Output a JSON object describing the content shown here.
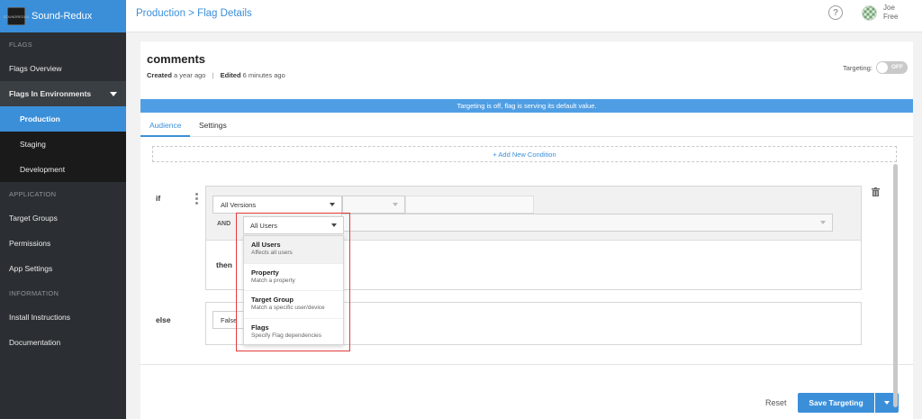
{
  "app": {
    "name": "Sound-Redux",
    "logo_text": "SOUNDREDUX"
  },
  "breadcrumb": "Production > Flag Details",
  "user": {
    "name": "Joe",
    "plan": "Free"
  },
  "sidebar": {
    "sections": [
      {
        "label": "FLAGS"
      },
      {
        "label": "APPLICATION"
      },
      {
        "label": "INFORMATION"
      }
    ],
    "items": {
      "flags_overview": "Flags Overview",
      "flags_in_environments": "Flags In Environments",
      "production": "Production",
      "staging": "Staging",
      "development": "Development",
      "target_groups": "Target Groups",
      "permissions": "Permissions",
      "app_settings": "App Settings",
      "install_instructions": "Install Instructions",
      "documentation": "Documentation"
    }
  },
  "flag": {
    "name": "comments",
    "created_label": "Created",
    "created_value": "a year ago",
    "edited_label": "Edited",
    "edited_value": "6 minutes ago"
  },
  "targeting": {
    "label": "Targeting:",
    "state": "OFF"
  },
  "banner": "Targeting is off, flag is serving its default value.",
  "tabs": [
    "Audience",
    "Settings"
  ],
  "add_condition": "+ Add New Condition",
  "rule": {
    "if": "if",
    "then": "then",
    "else": "else",
    "and": "AND",
    "version_select": "All Versions",
    "else_value": "False"
  },
  "dropdown": {
    "selected": "All Users",
    "options": [
      {
        "title": "All Users",
        "subtitle": "Affects all users"
      },
      {
        "title": "Property",
        "subtitle": "Match a property"
      },
      {
        "title": "Target Group",
        "subtitle": "Match a specific user/device"
      },
      {
        "title": "Flags",
        "subtitle": "Specify Flag dependencies"
      }
    ]
  },
  "footer": {
    "reset": "Reset",
    "save": "Save Targeting"
  },
  "colors": {
    "accent": "#3b8fd9",
    "sidebar": "#2b2f33",
    "highlight": "#e23b3b"
  }
}
